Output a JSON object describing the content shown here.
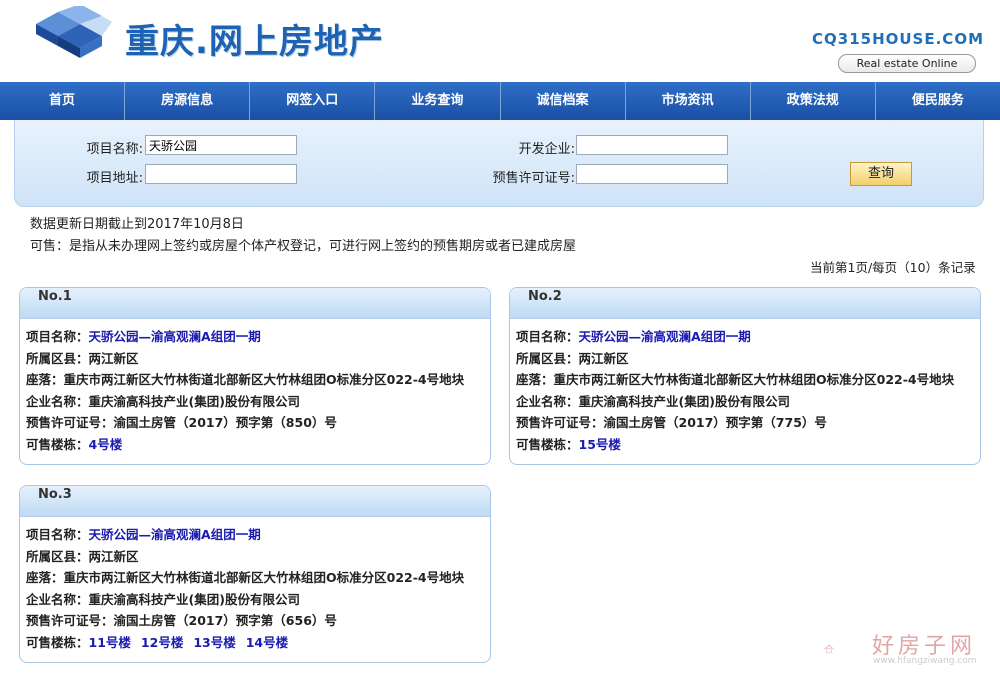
{
  "header": {
    "logo_text": "重庆.网上房地产",
    "site_url": "CQ315HOUSE.COM",
    "site_tag": "Real estate Online"
  },
  "nav": [
    "首页",
    "房源信息",
    "网签入口",
    "业务查询",
    "诚信档案",
    "市场资讯",
    "政策法规",
    "便民服务"
  ],
  "search": {
    "project_name_label": "项目名称:",
    "project_name_value": "天骄公园",
    "project_addr_label": "项目地址:",
    "project_addr_value": "",
    "developer_label": "开发企业:",
    "developer_value": "",
    "permit_label": "预售许可证号:",
    "permit_value": "",
    "query_button": "查询"
  },
  "notice": {
    "update_date": "数据更新日期截止到2017年10月8日",
    "definition": "可售：是指从未办理网上签约或房屋个体产权登记，可进行网上签约的预售期房或者已建成房屋",
    "paging": "当前第1页/每页（10）条记录"
  },
  "labels": {
    "project": "项目名称：",
    "district": "所属区县：",
    "location": "座落：",
    "company": "企业名称：",
    "permit": "预售许可证号：",
    "buildings": "可售楼栋："
  },
  "results": [
    {
      "no": "No.1",
      "project": "天骄公园—渝高观澜A组团一期",
      "district": "两江新区",
      "location": "重庆市两江新区大竹林街道北部新区大竹林组团O标准分区022-4号地块",
      "company": "重庆渝高科技产业(集团)股份有限公司",
      "permit": "渝国土房管（2017）预字第（850）号",
      "buildings": [
        "4号楼"
      ]
    },
    {
      "no": "No.2",
      "project": "天骄公园—渝高观澜A组团一期",
      "district": "两江新区",
      "location": "重庆市两江新区大竹林街道北部新区大竹林组团O标准分区022-4号地块",
      "company": "重庆渝高科技产业(集团)股份有限公司",
      "permit": "渝国土房管（2017）预字第（775）号",
      "buildings": [
        "15号楼"
      ]
    },
    {
      "no": "No.3",
      "project": "天骄公园—渝高观澜A组团一期",
      "district": "两江新区",
      "location": "重庆市两江新区大竹林街道北部新区大竹林组团O标准分区022-4号地块",
      "company": "重庆渝高科技产业(集团)股份有限公司",
      "permit": "渝国土房管（2017）预字第（656）号",
      "buildings": [
        "11号楼",
        "12号楼",
        "13号楼",
        "14号楼"
      ]
    }
  ],
  "watermark": {
    "text": "好房子网",
    "url": "www.hfangziwang.com"
  }
}
